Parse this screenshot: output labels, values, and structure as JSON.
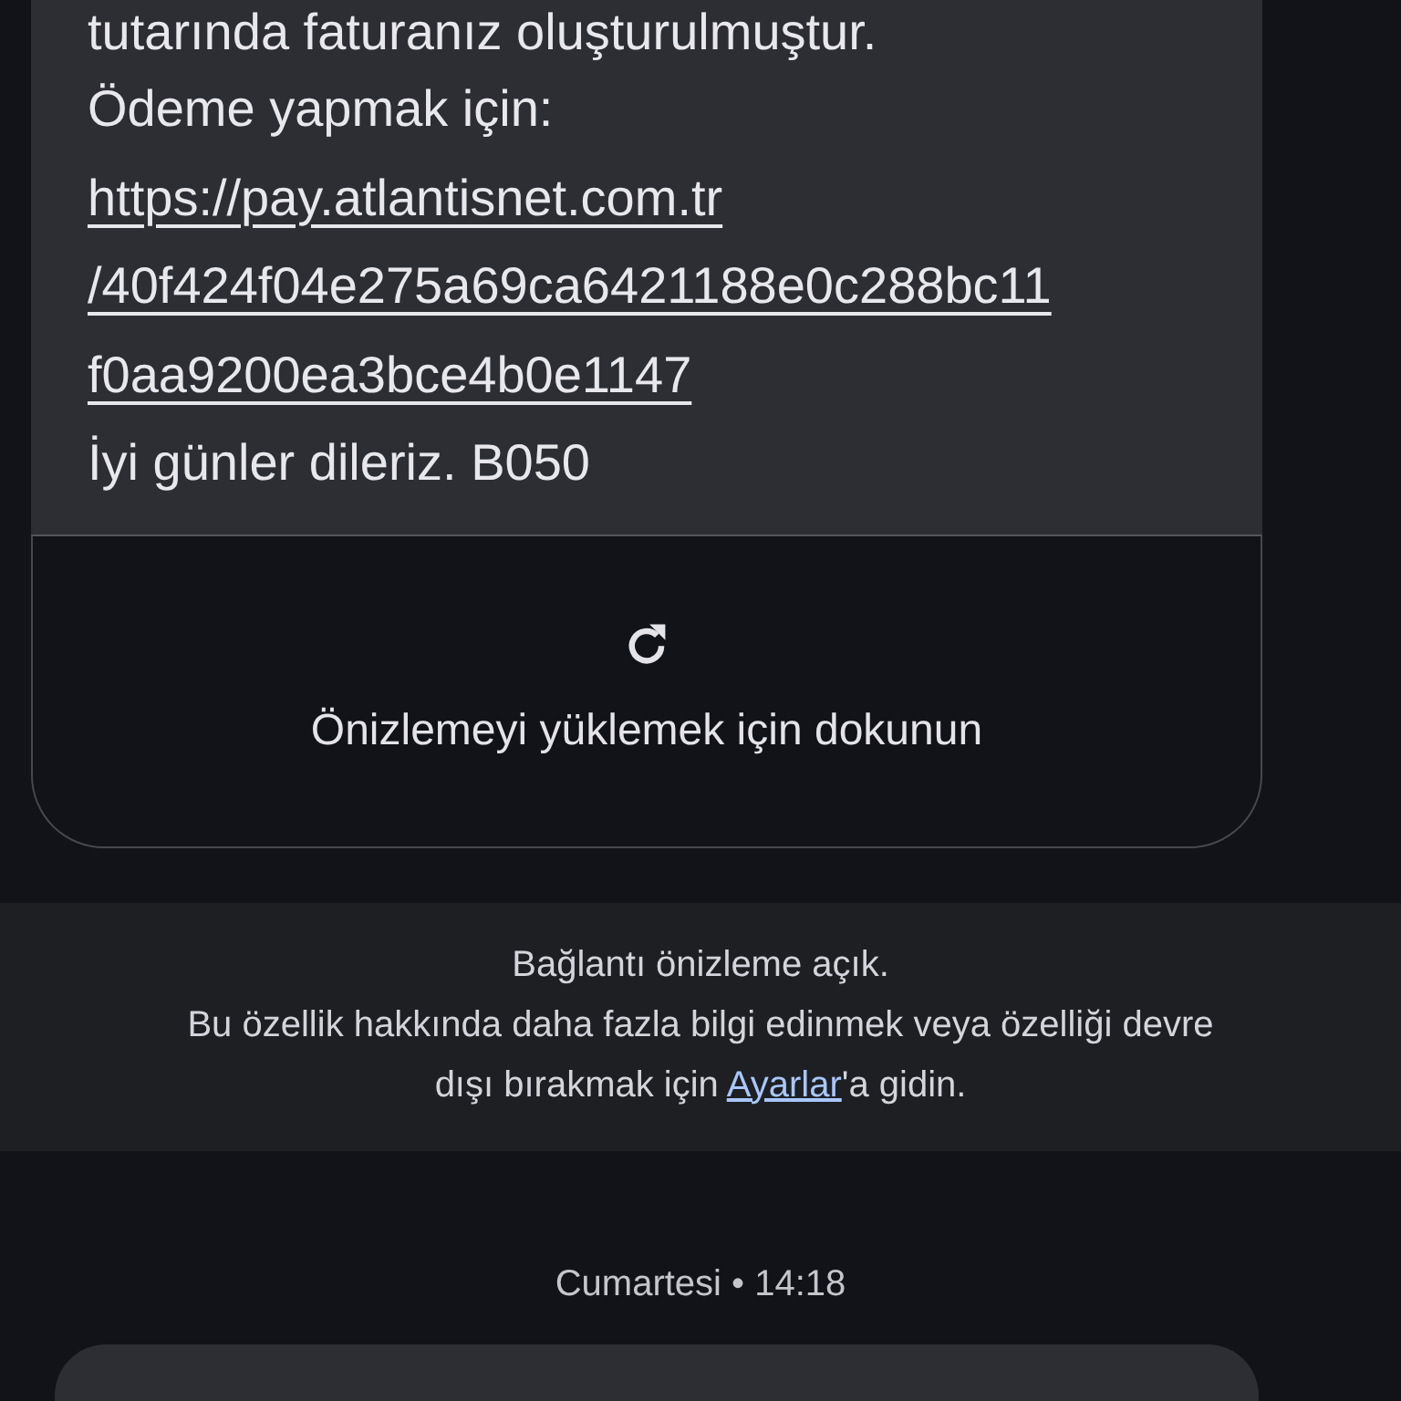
{
  "message": {
    "lines": [
      {
        "kind": "text",
        "text": "tutarında faturanız oluşturulmuştur."
      },
      {
        "kind": "text",
        "text": "Ödeme yapmak için:"
      },
      {
        "kind": "link",
        "text": "https://pay.atlantisnet.com.tr"
      },
      {
        "kind": "link",
        "text": "/40f424f04e275a69ca6421188e0c288bc11"
      },
      {
        "kind": "link",
        "text": "f0aa9200ea3bce4b0e1147"
      },
      {
        "kind": "text",
        "text": "İyi günler dileriz. B050"
      }
    ],
    "preview": {
      "label": "Önizlemeyi yüklemek için dokunun"
    }
  },
  "notice": {
    "title": "Bağlantı önizleme açık.",
    "before": "Bu özellik hakkında daha fazla bilgi edinmek veya özelliği devre dışı bırakmak için ",
    "link": "Ayarlar",
    "after": "'a gidin."
  },
  "date_separator": "Cumartesi • 14:18"
}
